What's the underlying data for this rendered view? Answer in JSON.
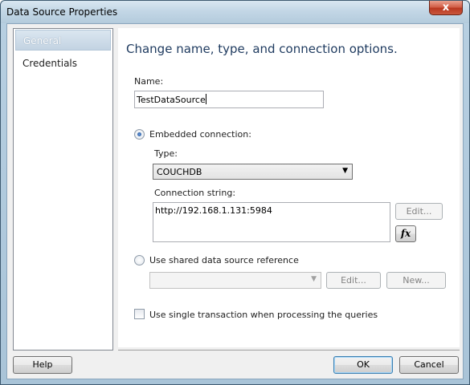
{
  "window": {
    "title": "Data Source Properties",
    "close_label": "x"
  },
  "sidebar": {
    "items": [
      {
        "label": "General",
        "selected": true
      },
      {
        "label": "Credentials",
        "selected": false
      }
    ]
  },
  "main": {
    "heading": "Change name, type, and connection options.",
    "name_label": "Name:",
    "name_value": "TestDataSource",
    "embedded_label": "Embedded connection:",
    "embedded_checked": true,
    "type_label": "Type:",
    "type_value": "COUCHDB",
    "conn_label": "Connection string:",
    "conn_value": "http://192.168.1.131:5984",
    "edit_label": "Edit...",
    "fx_label": "fx",
    "shared_label": "Use shared data source reference",
    "shared_checked": false,
    "shared_value": "",
    "shared_edit_label": "Edit...",
    "shared_new_label": "New...",
    "single_txn_label": "Use single transaction when processing the queries",
    "single_txn_checked": false
  },
  "footer": {
    "help_label": "Help",
    "ok_label": "OK",
    "cancel_label": "Cancel"
  }
}
